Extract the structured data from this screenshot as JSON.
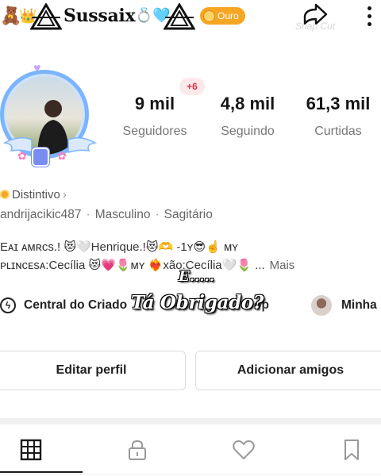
{
  "header": {
    "username": "Sussaix",
    "emoji_left": "🧸",
    "emoji_crown": "👑",
    "emoji_ring": "💍",
    "emoji_heart": "🩵",
    "badge_label": "Ouro",
    "watermark": "Snap Cut",
    "icons": [
      "teddy-bear-icon",
      "crown-icon",
      "triangle-emblem-icon",
      "ring-icon",
      "heart-icon",
      "share-icon",
      "more-icon"
    ]
  },
  "profile": {
    "new_badge": "+6",
    "stats": [
      {
        "value": "9 mil",
        "label": "Seguidores"
      },
      {
        "value": "4,8 mil",
        "label": "Seguindo"
      },
      {
        "value": "61,3 mil",
        "label": "Curtidas"
      }
    ],
    "distintivo": "Distintivo",
    "meta": {
      "handle": "andrijacikic487",
      "gender": "Masculino",
      "sign": "Sagitário"
    },
    "bio_line1": "Eᴀɪ ᴀᴍʀᴄs.! 😻🤍Henrique.!😻🫶 -1ʏ😎☝️  ᴍʏ",
    "bio_line2": "ᴘʟɪɴᴄᴇsᴀ:Cecília 😻💗🌷ᴍʏ ❤️‍🔥xãᴏ:Cecília🤍🌷 ...",
    "bio_more": "Mais"
  },
  "overlay": {
    "line1": "E.....",
    "line2": "Tá Obrigado?"
  },
  "shortcuts": {
    "creator": "Central do Criado",
    "shop": "op",
    "mine": "Minha"
  },
  "buttons": {
    "edit": "Editar perfil",
    "add": "Adicionar amigos"
  },
  "tabs": [
    "grid-icon",
    "lock-icon",
    "heart-icon",
    "bookmark-icon"
  ],
  "colors": {
    "accent_red": "#e8304b",
    "gold": "#f5a623",
    "ring_blue": "#7bb4ff"
  }
}
